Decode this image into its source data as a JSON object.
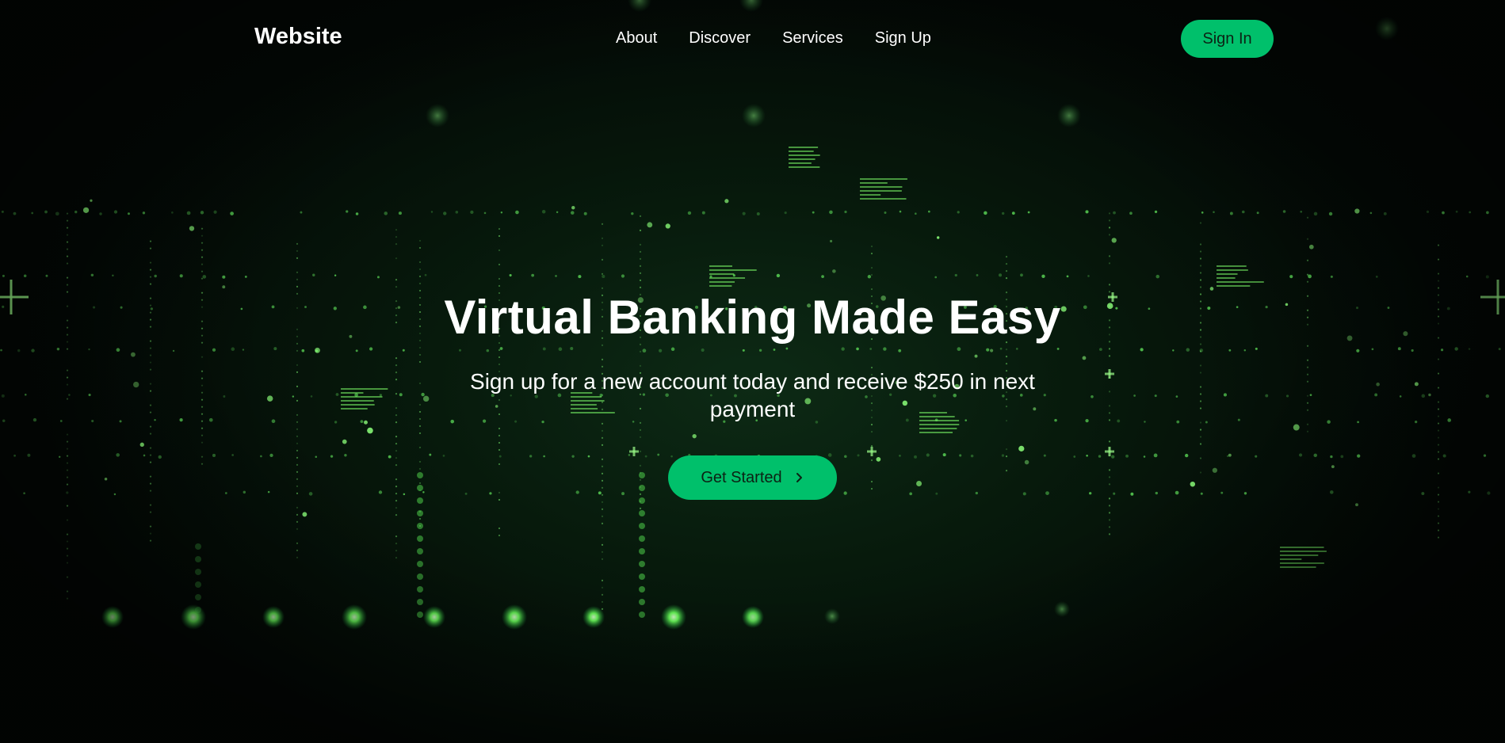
{
  "header": {
    "brand": "Website",
    "nav": [
      {
        "label": "About"
      },
      {
        "label": "Discover"
      },
      {
        "label": "Services"
      },
      {
        "label": "Sign Up"
      }
    ],
    "signin_label": "Sign In"
  },
  "hero": {
    "title": "Virtual Banking Made Easy",
    "subtitle": "Sign up for a new account today and receive $250 in next payment",
    "cta_label": "Get Started",
    "cta_icon": "chevron-right-icon"
  },
  "colors": {
    "accent": "#00c06b",
    "background": "#040a06",
    "glow": "#7dff6a",
    "button_text": "#0c2214"
  }
}
